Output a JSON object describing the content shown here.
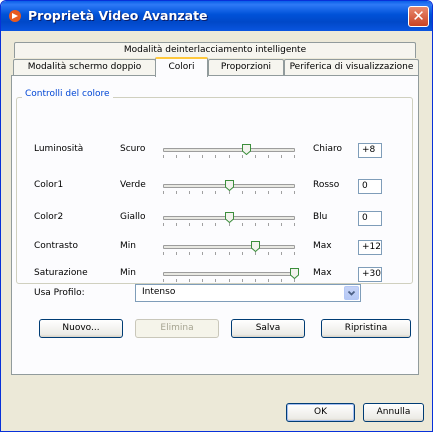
{
  "window": {
    "title": "Proprietà Video Avanzate",
    "close_glyph": "✕",
    "icon": "app-icon"
  },
  "tabs": {
    "top": [
      {
        "label": "Modalità deinterlacciamento intelligente"
      }
    ],
    "bottom": [
      {
        "label": "Modalità schermo doppio"
      },
      {
        "label": "Colori",
        "selected": true
      },
      {
        "label": "Proporzioni"
      },
      {
        "label": "Periferica di visualizzazione"
      }
    ]
  },
  "color_controls": {
    "group_label": "Controlli del colore",
    "sliders": [
      {
        "name": "Luminosità",
        "min_label": "Scuro",
        "max_label": "Chiaro",
        "value": "+8",
        "position_fraction": 0.63
      },
      {
        "name": "Color1",
        "min_label": "Verde",
        "max_label": "Rosso",
        "value": "0",
        "position_fraction": 0.5
      },
      {
        "name": "Color2",
        "min_label": "Giallo",
        "max_label": "Blu",
        "value": "0",
        "position_fraction": 0.5
      },
      {
        "name": "Contrasto",
        "min_label": "Min",
        "max_label": "Max",
        "value": "+12",
        "position_fraction": 0.7
      },
      {
        "name": "Saturazione",
        "min_label": "Min",
        "max_label": "Max",
        "value": "+30",
        "position_fraction": 1.0
      }
    ]
  },
  "profile": {
    "label": "Usa Profilo:",
    "selected": "Intenso"
  },
  "profile_buttons": {
    "new": "Nuovo...",
    "delete": "Elimina",
    "save": "Salva",
    "restore": "Ripristina"
  },
  "footer_buttons": {
    "ok": "OK",
    "cancel": "Annulla"
  },
  "colors": {
    "title_bar": "#0054E3",
    "close_button": "#D9542F",
    "group_label": "#0046D5",
    "selected_tab_accent": "#FFC83C",
    "window_bg": "#ECE9D8"
  }
}
